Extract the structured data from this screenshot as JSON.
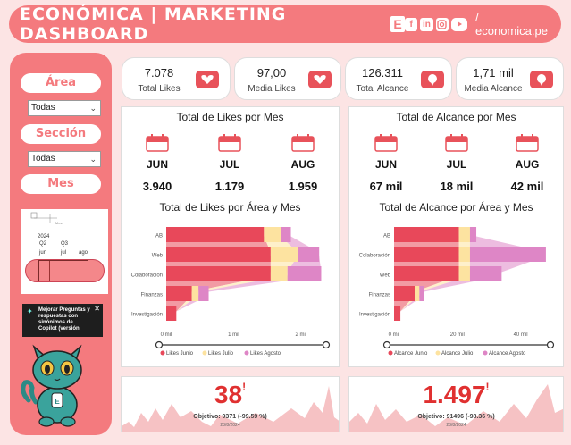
{
  "header": {
    "title": "ECONÓMICA | MARKETING DASHBOARD",
    "logo_letter": "E",
    "site": "/ economica.pe",
    "social_icons": [
      "facebook-icon",
      "linkedin-icon",
      "instagram-icon",
      "youtube-icon"
    ]
  },
  "sidebar": {
    "area_label": "Área",
    "area_value": "Todas",
    "seccion_label": "Sección",
    "seccion_value": "Todas",
    "mes_label": "Mes",
    "timeline": {
      "year": "2024",
      "quarters": [
        "Q2",
        "Q3"
      ],
      "months": [
        "jun",
        "jul",
        "ago"
      ]
    },
    "copilot_text": "Mejorar Preguntas y respuestas con sinónimos de Copilot (versión"
  },
  "kpis": [
    {
      "value": "7.078",
      "label": "Total Likes",
      "icon": "heart-icon"
    },
    {
      "value": "97,00",
      "label": "Media Likes",
      "icon": "heart-icon"
    },
    {
      "value": "126.311",
      "label": "Total Alcance",
      "icon": "chat-icon"
    },
    {
      "value": "1,71 mil",
      "label": "Media Alcance",
      "icon": "chat-icon"
    }
  ],
  "likes_panel": {
    "title": "Total de Likes por Mes",
    "months": [
      "JUN",
      "JUL",
      "AUG"
    ],
    "values": [
      "3.940",
      "1.179",
      "1.959"
    ]
  },
  "alcance_panel": {
    "title": "Total de Alcance por Mes",
    "months": [
      "JUN",
      "JUL",
      "AUG"
    ],
    "values": [
      "67 mil",
      "18 mil",
      "42 mil"
    ]
  },
  "likes_chart_title": "Total de Likes por Área y Mes",
  "alcance_chart_title": "Total de Alcance por Área y Mes",
  "bottom_likes": {
    "value": "38",
    "mark": "!",
    "objetivo": "Objetivo: 9371 (-99.59 %)",
    "date": "23/8/2024"
  },
  "bottom_alcance": {
    "value": "1.497",
    "mark": "!",
    "objetivo": "Objetivo: 91496 (-98.36 %)",
    "date": "23/8/2024"
  },
  "colors": {
    "junio": "#e8485a",
    "julio": "#fde3a0",
    "agosto": "#de86c6",
    "accent": "#f47a7e"
  },
  "chart_data": [
    {
      "type": "bar",
      "title": "Total de Likes por Área y Mes",
      "categories": [
        "AB",
        "Web",
        "Colaboración",
        "Finanzas",
        "Investigación"
      ],
      "series": [
        {
          "name": "Likes Junio",
          "values": [
            1450,
            1550,
            1550,
            380,
            150
          ]
        },
        {
          "name": "Likes Julio",
          "values": [
            250,
            400,
            250,
            100,
            0
          ]
        },
        {
          "name": "Likes Agosto",
          "values": [
            150,
            320,
            500,
            150,
            0
          ]
        }
      ],
      "xticks": [
        "0 mil",
        "1 mil",
        "2 mil"
      ],
      "xlim": [
        0,
        2400
      ],
      "legend": "bottom"
    },
    {
      "type": "bar",
      "title": "Total de Alcance por Área y Mes",
      "categories": [
        "AB",
        "Colaboración",
        "Web",
        "Finanzas",
        "Investigación"
      ],
      "series": [
        {
          "name": "Alcance Junio",
          "values": [
            20500,
            20500,
            20500,
            6500,
            2000
          ]
        },
        {
          "name": "Alcance Julio",
          "values": [
            3500,
            3500,
            3500,
            1500,
            0
          ]
        },
        {
          "name": "Alcance Agosto",
          "values": [
            2000,
            24000,
            10000,
            1500,
            0
          ]
        }
      ],
      "xticks": [
        "0 mil",
        "20 mil",
        "40 mil"
      ],
      "xlim": [
        0,
        50000
      ],
      "legend": "bottom"
    }
  ]
}
